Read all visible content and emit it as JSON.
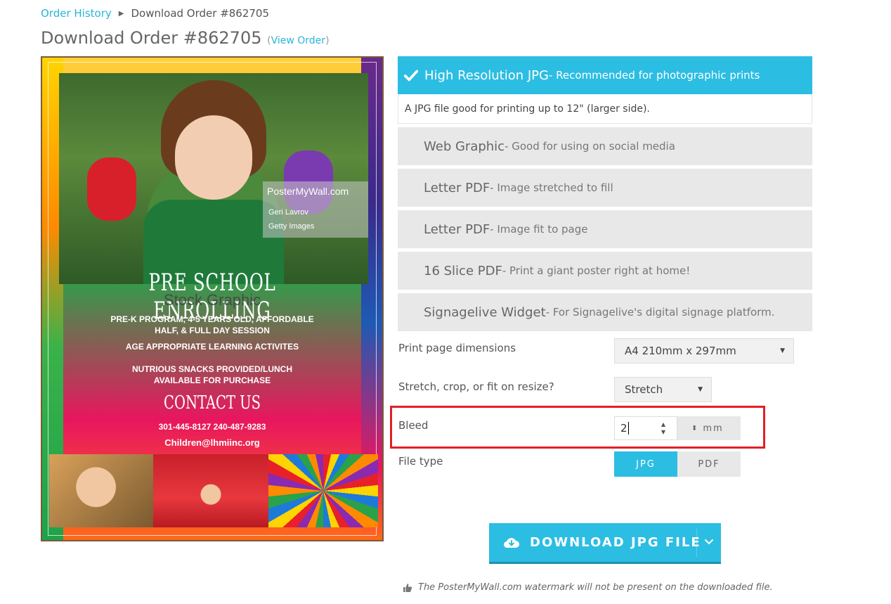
{
  "breadcrumb": {
    "link": "Order History",
    "current": "Download Order #862705"
  },
  "page": {
    "title": "Download Order #862705",
    "view_order_open": "(",
    "view_order_link": "View Order",
    "view_order_close": ")"
  },
  "poster": {
    "watermark_site": "PosterMyWall.com",
    "credit_1": "Geri Lavrov",
    "credit_2": "Getty Images",
    "headline": "PRE SCHOOL ENROLLING",
    "stock_watermark": "Stock Graphic",
    "line_1": "PRE-K PROGRAM, 4-5 YEARS OLD, AFFORDABLE",
    "line_2": "HALF, & FULL DAY SESSION",
    "line_3": "AGE APPROPRIATE LEARNING ACTIVITES",
    "line_4": "NUTRIOUS SNACKS PROVIDED/LUNCH",
    "line_5": "AVAILABLE FOR PURCHASE",
    "contact_title": "CONTACT US",
    "phones": "301-445-8127   240-487-9283",
    "email": "Children@lhmiinc.org"
  },
  "options": {
    "selected": {
      "name": "High Resolution JPG",
      "desc": " - Recommended for photographic prints",
      "detail": "A JPG file good for printing up to 12\" (larger side)."
    },
    "items": [
      {
        "name": "Web Graphic",
        "desc": " - Good for using on social media"
      },
      {
        "name": "Letter PDF",
        "desc": " - Image stretched to fill"
      },
      {
        "name": "Letter PDF",
        "desc": " - Image fit to page"
      },
      {
        "name": "16 Slice PDF",
        "desc": " - Print a giant poster right at home!"
      },
      {
        "name": "Signagelive Widget",
        "desc": " - For Signagelive's digital signage platform."
      }
    ]
  },
  "form": {
    "dimensions_label": "Print page dimensions",
    "dimensions_value": "A4 210mm x 297mm",
    "resize_label": "Stretch, crop, or fit on resize?",
    "resize_value": "Stretch",
    "bleed_label": "Bleed",
    "bleed_value": "2",
    "bleed_unit": "mm",
    "filetype_label": "File type",
    "filetype_jpg": "JPG",
    "filetype_pdf": "PDF"
  },
  "download": {
    "label": "DOWNLOAD JPG FILE"
  },
  "footnote": {
    "text": "The PosterMyWall.com watermark will not be present on the downloaded file."
  },
  "colors": {
    "accent": "#2cbde3",
    "link": "#29b6d9",
    "highlight": "#e31e26"
  }
}
